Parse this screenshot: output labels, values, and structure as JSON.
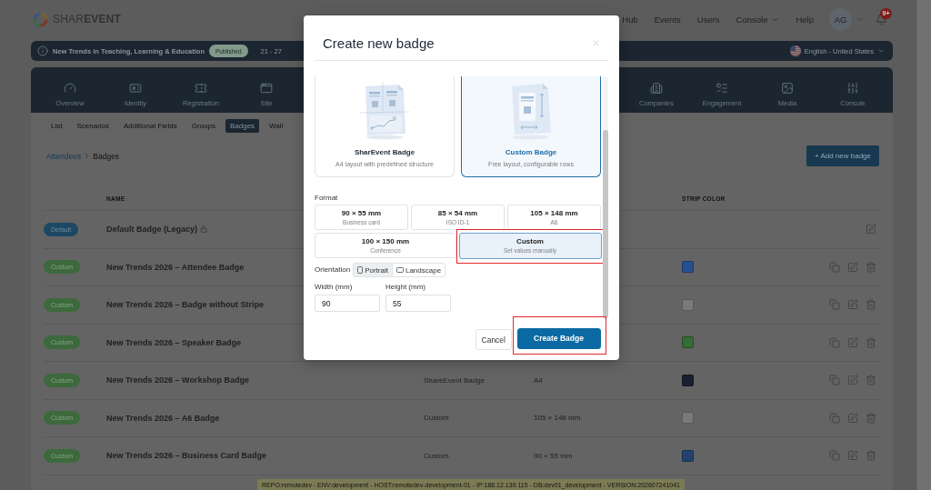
{
  "header": {
    "logo": "SHAR**EVENT**",
    "nav": [
      {
        "label": "Hub",
        "dropdown": false
      },
      {
        "label": "Events",
        "dropdown": false
      },
      {
        "label": "Users",
        "dropdown": false
      },
      {
        "label": "Console",
        "dropdown": true
      },
      {
        "label": "Help",
        "dropdown": false
      }
    ],
    "avatar": "AG",
    "notifications": "9+"
  },
  "event_bar": {
    "title": "New Trends in Teaching, Learning & Education",
    "status": "Published",
    "dates": "21 - 27",
    "language": "English - United States"
  },
  "module_nav": {
    "items_left": [
      "Overview",
      "Identity",
      "Registration",
      "Site"
    ],
    "items_right": [
      "Companies",
      "Engagement",
      "Media",
      "Console"
    ]
  },
  "subtabs": [
    {
      "label": "List",
      "selected": false
    },
    {
      "label": "Scenarios",
      "selected": false
    },
    {
      "label": "Additional Fields",
      "selected": false
    },
    {
      "label": "Groups",
      "selected": false
    },
    {
      "label": "Badges",
      "selected": true
    },
    {
      "label": "Wall",
      "selected": false
    }
  ],
  "breadcrumb": {
    "parent": "Attendees",
    "current": "Badges"
  },
  "add_button": "+ Add new badge",
  "table": {
    "columns": {
      "name": "NAME",
      "strip_color": "STRIP COLOR"
    },
    "rows": [
      {
        "tag": {
          "label": "Default",
          "color": "#1d4763"
        },
        "name": "Default Badge (Legacy)",
        "locked": true
      },
      {
        "tag": {
          "label": "Custom",
          "color": "#3c6a3c"
        },
        "name": "New Trends 2026 – Attendee Badge",
        "locked": false,
        "color": "#27508f"
      },
      {
        "tag": {
          "label": "Custom",
          "color": "#3c6a3c"
        },
        "name": "New Trends 2026 – Badge without Stripe",
        "locked": false,
        "color": "#7a7a7a"
      },
      {
        "tag": {
          "label": "Custom",
          "color": "#3c6a3c"
        },
        "name": "New Trends 2026 – Speaker Badge",
        "locked": false,
        "color": "#356b35"
      },
      {
        "tag": {
          "label": "Custom",
          "color": "#3c6a3c"
        },
        "name": "New Trends 2026 – Workshop Badge",
        "type": "ShareEvent Badge",
        "format": "A4",
        "locked": false,
        "color": "#17202f"
      },
      {
        "tag": {
          "label": "Custom",
          "color": "#3c6a3c"
        },
        "name": "New Trends 2026 – A6 Badge",
        "type": "Custom",
        "format": "105 × 148 mm",
        "locked": false,
        "color": "#7a7a7a"
      },
      {
        "tag": {
          "label": "Custom",
          "color": "#3c6a3c"
        },
        "name": "New Trends 2026 – Business Card Badge",
        "type": "Custom",
        "format": "90 × 55 mm",
        "locked": false,
        "color": "#22426e"
      }
    ]
  },
  "modal": {
    "title": "Create new badge",
    "templates": [
      {
        "kind": "standard",
        "title": "SharEvent Badge",
        "description": "A4 layout with predefined structure",
        "selected": false
      },
      {
        "kind": "custom",
        "title": "Custom Badge",
        "description": "Free layout, configurable rows",
        "selected": true
      }
    ],
    "format_label": "Format",
    "formats": [
      {
        "size": "90 × 55 mm",
        "name": "Business card",
        "selected": false,
        "highlighted": false
      },
      {
        "size": "85 × 54 mm",
        "name": "ISO ID-1",
        "selected": false,
        "highlighted": false
      },
      {
        "size": "105 × 148 mm",
        "name": "A6",
        "selected": false,
        "highlighted": false
      },
      {
        "size": "100 × 150 mm",
        "name": "Conference",
        "selected": false,
        "highlighted": false
      },
      {
        "size": "Custom",
        "name": "Set values manually",
        "selected": true,
        "highlighted": true
      }
    ],
    "orientation": {
      "label": "Orientation",
      "options": [
        {
          "label": "Portrait",
          "selected": true
        },
        {
          "label": "Landscape",
          "selected": false
        }
      ]
    },
    "width": {
      "label": "Width (mm)",
      "value": "90"
    },
    "height": {
      "label": "Height (mm)",
      "value": "55"
    },
    "buttons": [
      {
        "label": "Cancel",
        "kind": "secondary",
        "highlighted": false
      },
      {
        "label": "Create Badge",
        "kind": "primary",
        "highlighted": true
      }
    ]
  },
  "env_bar": "REPO:remotedev - ENV:development - HOST:remotedev-development-01 - IP:188.12.139.115 - DB:dev01_development - VERSION:202607241041"
}
